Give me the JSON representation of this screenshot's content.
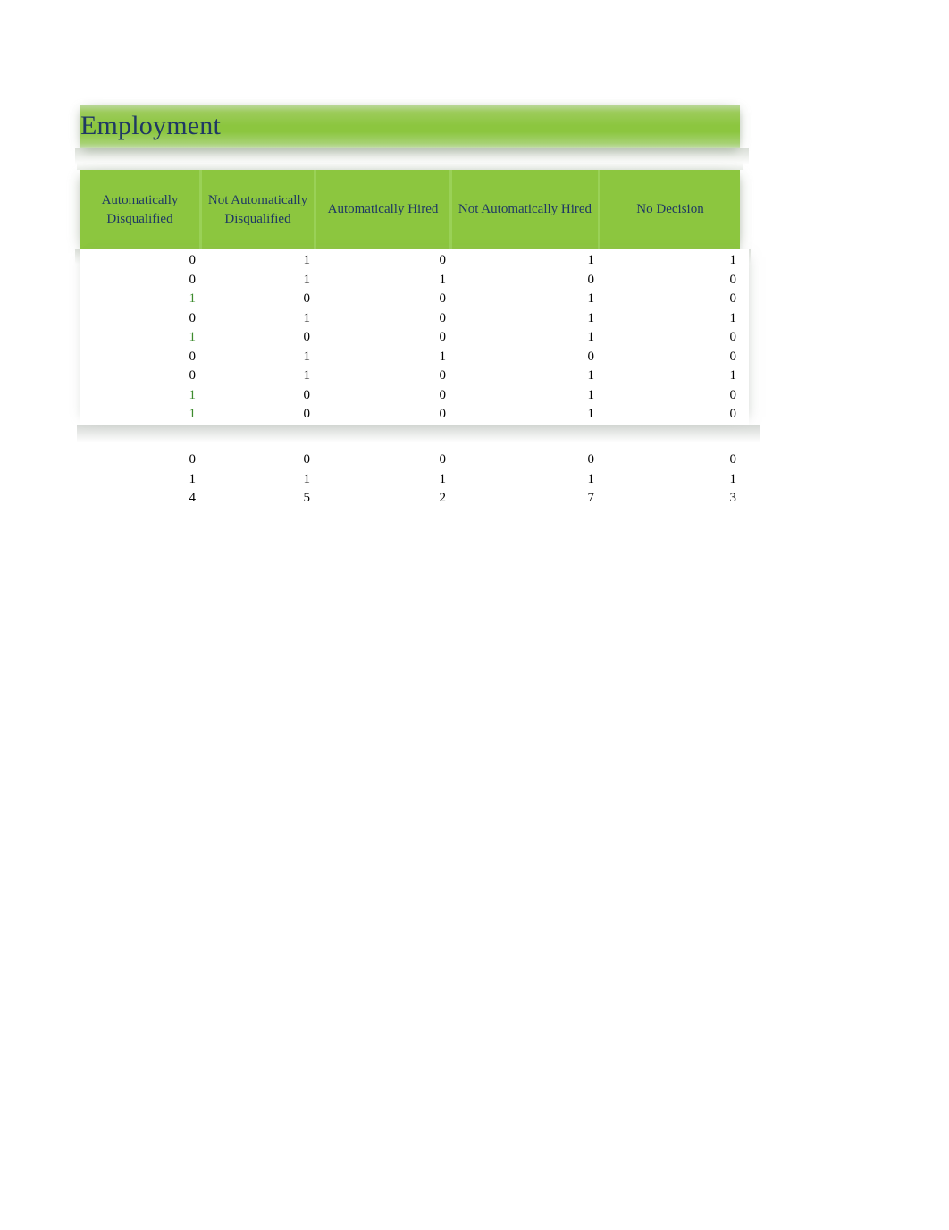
{
  "sheet": {
    "title": "Employment",
    "accent_green": "#8CC63F",
    "title_text_color": "#1F3864",
    "value_green": "#3D8B2E",
    "value_black": "#000000"
  },
  "table": {
    "columns": [
      "Automatically Disqualified",
      "Not Automatically Disqualified",
      "Automatically Hired",
      "Not Automatically Hired",
      "No Decision"
    ],
    "rows": [
      {
        "values": [
          "0",
          "1",
          "0",
          "1",
          "1"
        ],
        "highlight": [
          false,
          false,
          false,
          false,
          false
        ]
      },
      {
        "values": [
          "0",
          "1",
          "1",
          "0",
          "0"
        ],
        "highlight": [
          false,
          false,
          false,
          false,
          false
        ]
      },
      {
        "values": [
          "1",
          "0",
          "0",
          "1",
          "0"
        ],
        "highlight": [
          true,
          false,
          false,
          false,
          false
        ]
      },
      {
        "values": [
          "0",
          "1",
          "0",
          "1",
          "1"
        ],
        "highlight": [
          false,
          false,
          false,
          false,
          false
        ]
      },
      {
        "values": [
          "1",
          "0",
          "0",
          "1",
          "0"
        ],
        "highlight": [
          true,
          false,
          false,
          false,
          false
        ]
      },
      {
        "values": [
          "0",
          "1",
          "1",
          "0",
          "0"
        ],
        "highlight": [
          false,
          false,
          false,
          false,
          false
        ]
      },
      {
        "values": [
          "0",
          "1",
          "0",
          "1",
          "1"
        ],
        "highlight": [
          false,
          false,
          false,
          false,
          false
        ]
      },
      {
        "values": [
          "1",
          "0",
          "0",
          "1",
          "0"
        ],
        "highlight": [
          true,
          false,
          false,
          false,
          false
        ]
      },
      {
        "values": [
          "1",
          "0",
          "0",
          "1",
          "0"
        ],
        "highlight": [
          true,
          false,
          false,
          false,
          false
        ]
      }
    ],
    "summary_rows": [
      {
        "values": [
          "0",
          "0",
          "0",
          "0",
          "0"
        ],
        "highlight": [
          false,
          false,
          false,
          false,
          false
        ]
      },
      {
        "values": [
          "1",
          "1",
          "1",
          "1",
          "1"
        ],
        "highlight": [
          false,
          false,
          false,
          false,
          false
        ]
      },
      {
        "values": [
          "4",
          "5",
          "2",
          "7",
          "3"
        ],
        "highlight": [
          false,
          false,
          false,
          false,
          false
        ]
      }
    ]
  }
}
